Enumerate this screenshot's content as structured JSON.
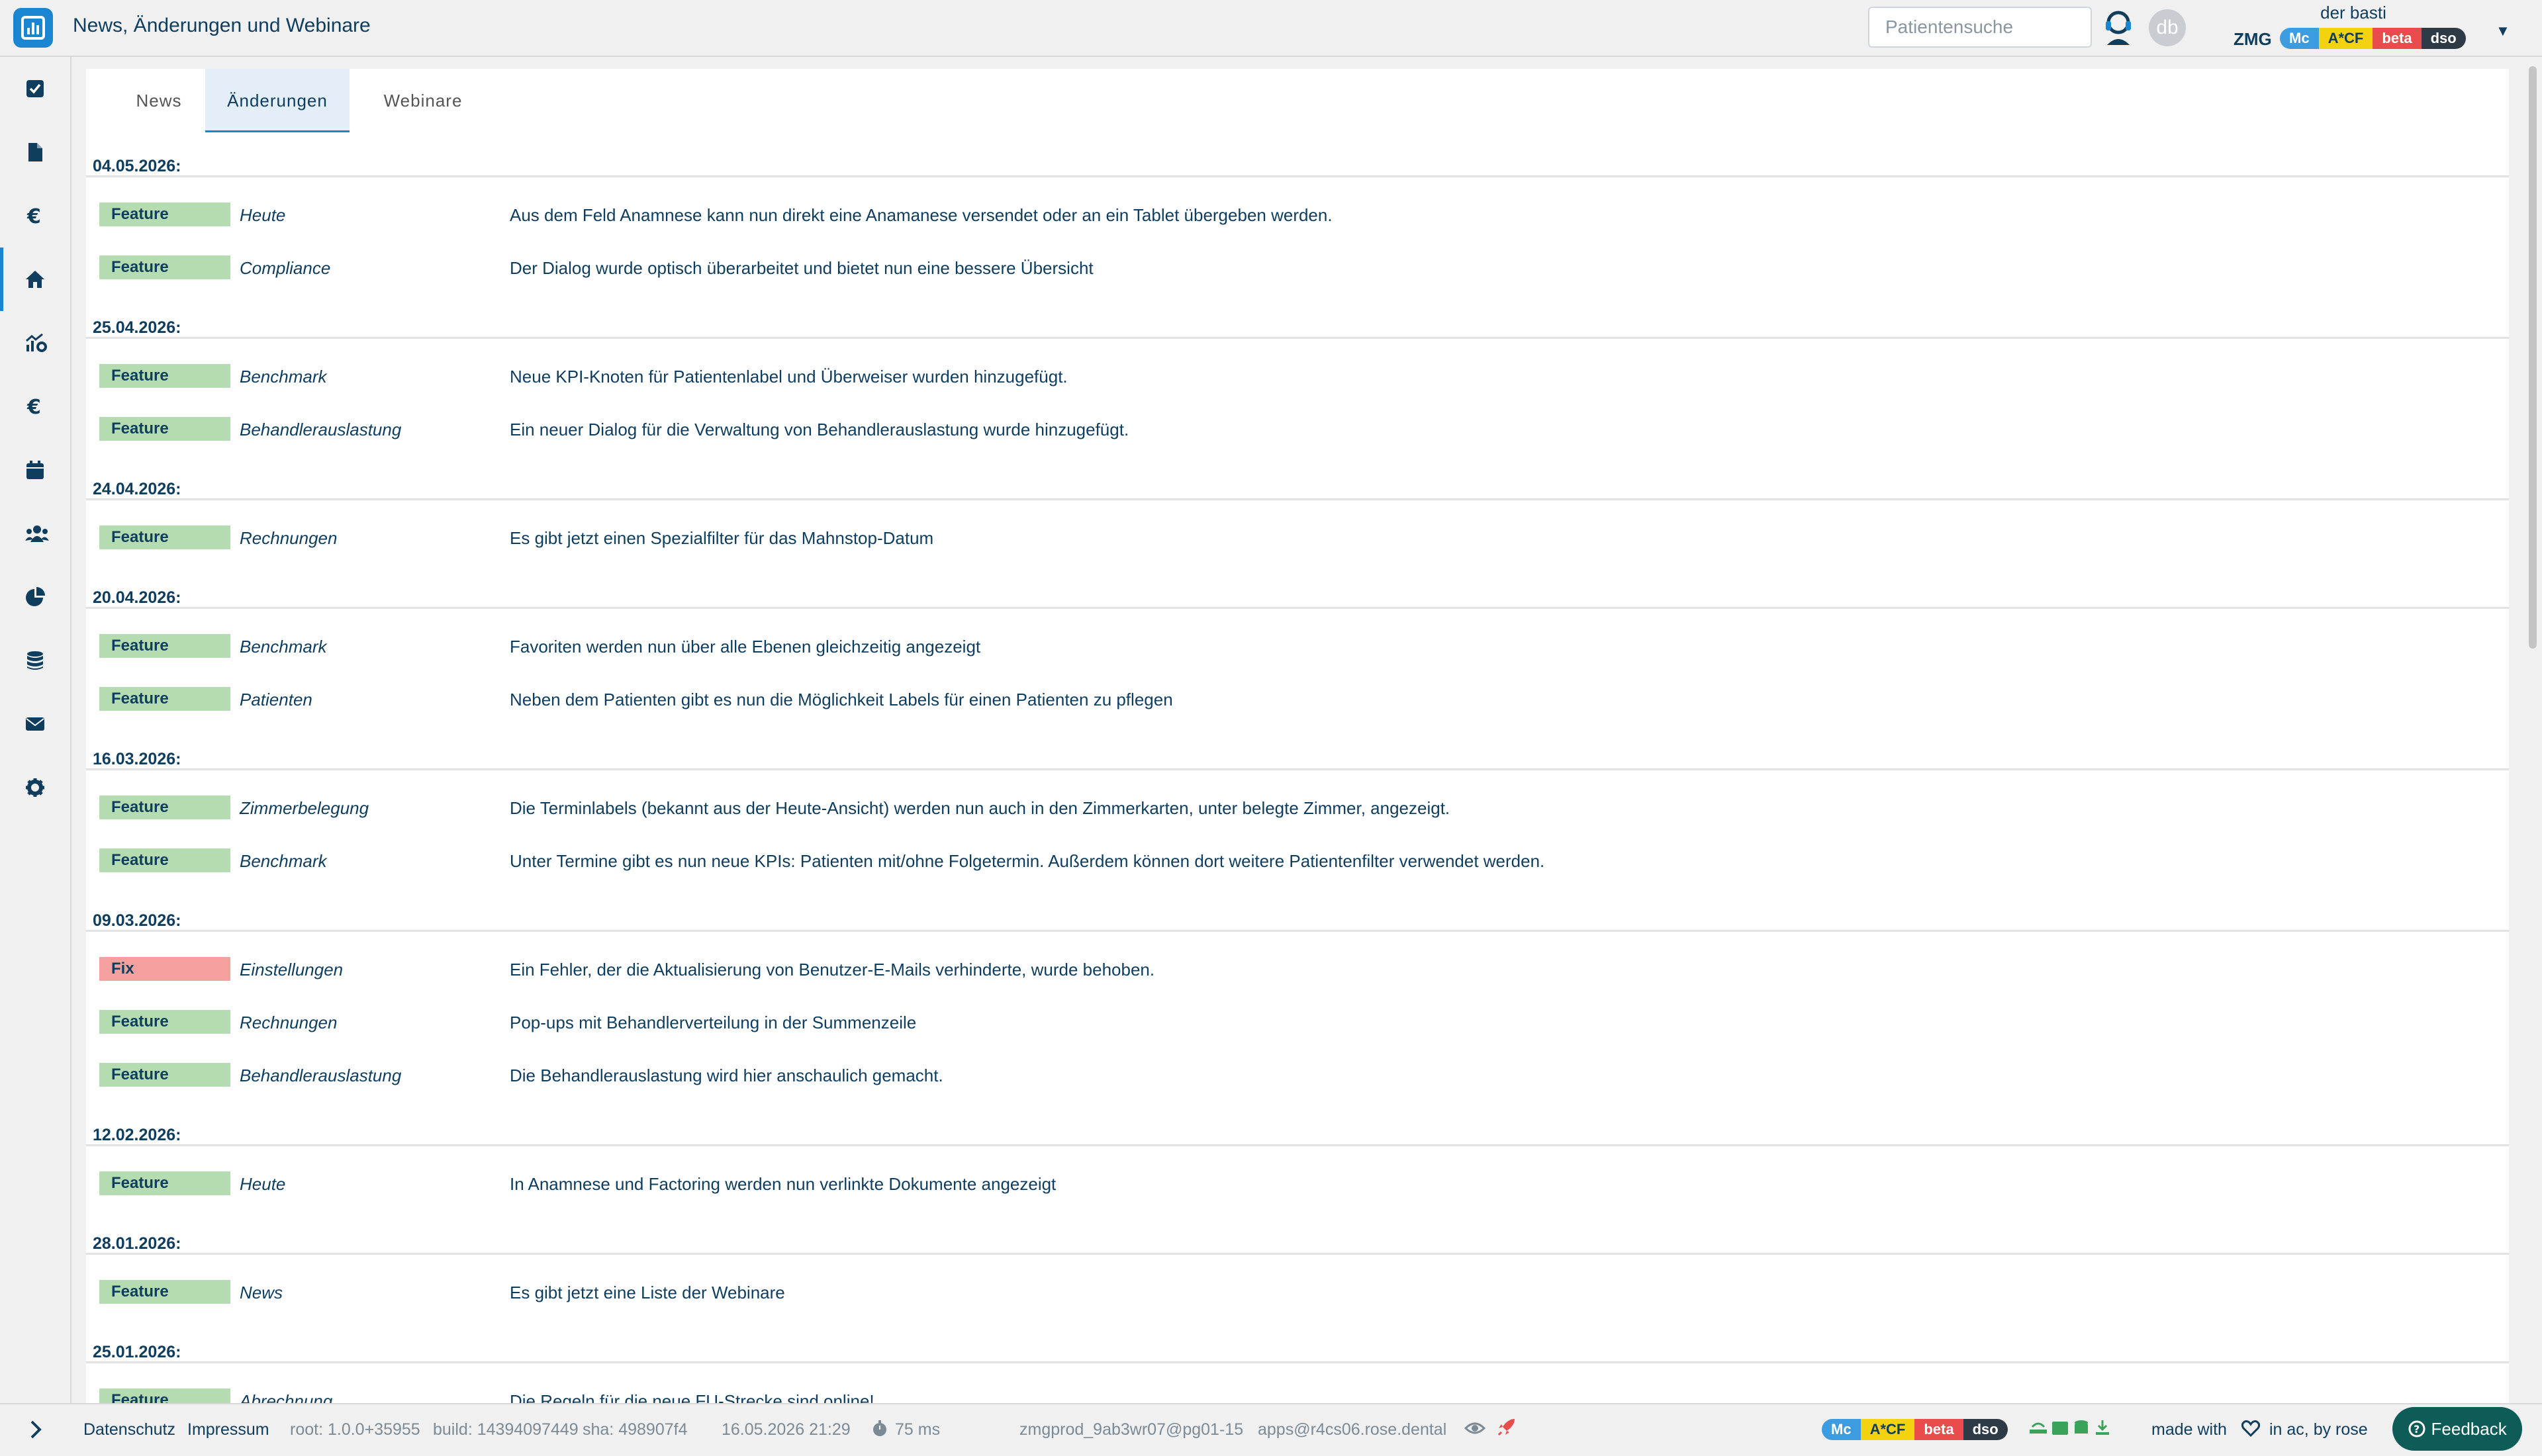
{
  "header": {
    "title": "News, Änderungen und Webinare",
    "search_placeholder": "Patientensuche",
    "avatar_initials": "db",
    "user_name": "der basti",
    "org": "ZMG",
    "badges": [
      "Mc",
      "A*CF",
      "beta",
      "dso"
    ]
  },
  "sidebar": {
    "items": [
      {
        "icon": "checkbox-icon"
      },
      {
        "icon": "document-icon"
      },
      {
        "icon": "euro-icon"
      },
      {
        "icon": "home-icon",
        "active": true
      },
      {
        "icon": "chart-settings-icon"
      },
      {
        "icon": "euro-icon"
      },
      {
        "icon": "calendar-icon"
      },
      {
        "icon": "users-icon"
      },
      {
        "icon": "pie-chart-icon"
      },
      {
        "icon": "database-icon"
      },
      {
        "icon": "mail-icon"
      },
      {
        "icon": "gear-icon"
      }
    ]
  },
  "tabs": [
    {
      "label": "News"
    },
    {
      "label": "Änderungen",
      "active": true
    },
    {
      "label": "Webinare"
    }
  ],
  "changes": [
    {
      "date": "04.05.2026:",
      "entries": [
        {
          "type": "Feature",
          "category": "Heute",
          "text": "Aus dem Feld Anamnese kann nun direkt eine Anamanese versendet oder an ein Tablet übergeben werden."
        },
        {
          "type": "Feature",
          "category": "Compliance",
          "text": "Der Dialog wurde optisch überarbeitet und bietet nun eine bessere Übersicht"
        }
      ]
    },
    {
      "date": "25.04.2026:",
      "entries": [
        {
          "type": "Feature",
          "category": "Benchmark",
          "text": "Neue KPI-Knoten für Patientenlabel und Überweiser wurden hinzugefügt."
        },
        {
          "type": "Feature",
          "category": "Behandlerauslastung",
          "text": "Ein neuer Dialog für die Verwaltung von Behandlerauslastung wurde hinzugefügt."
        }
      ]
    },
    {
      "date": "24.04.2026:",
      "entries": [
        {
          "type": "Feature",
          "category": "Rechnungen",
          "text": "Es gibt jetzt einen Spezialfilter für das Mahnstop-Datum"
        }
      ]
    },
    {
      "date": "20.04.2026:",
      "entries": [
        {
          "type": "Feature",
          "category": "Benchmark",
          "text": "Favoriten werden nun über alle Ebenen gleichzeitig angezeigt"
        },
        {
          "type": "Feature",
          "category": "Patienten",
          "text": "Neben dem Patienten gibt es nun die Möglichkeit Labels für einen Patienten zu pflegen"
        }
      ]
    },
    {
      "date": "16.03.2026:",
      "entries": [
        {
          "type": "Feature",
          "category": "Zimmerbelegung",
          "text": "Die Terminlabels (bekannt aus der Heute-Ansicht) werden nun auch in den Zimmerkarten, unter belegte Zimmer, angezeigt."
        },
        {
          "type": "Feature",
          "category": "Benchmark",
          "text": "Unter Termine gibt es nun neue KPIs: Patienten mit/ohne Folgetermin. Außerdem können dort weitere Patientenfilter verwendet werden."
        }
      ]
    },
    {
      "date": "09.03.2026:",
      "entries": [
        {
          "type": "Fix",
          "category": "Einstellungen",
          "text": "Ein Fehler, der die Aktualisierung von Benutzer-E-Mails verhinderte, wurde behoben."
        },
        {
          "type": "Feature",
          "category": "Rechnungen",
          "text": "Pop-ups mit Behandlerverteilung in der Summenzeile"
        },
        {
          "type": "Feature",
          "category": "Behandlerauslastung",
          "text": "Die Behandlerauslastung wird hier anschaulich gemacht."
        }
      ]
    },
    {
      "date": "12.02.2026:",
      "entries": [
        {
          "type": "Feature",
          "category": "Heute",
          "text": "In Anamnese und Factoring werden nun verlinkte Dokumente angezeigt"
        }
      ]
    },
    {
      "date": "28.01.2026:",
      "entries": [
        {
          "type": "Feature",
          "category": "News",
          "text": "Es gibt jetzt eine Liste der Webinare"
        }
      ]
    },
    {
      "date": "25.01.2026:",
      "entries": [
        {
          "type": "Feature",
          "category": "Abrechnung",
          "text": "Die Regeln für die neue FU-Strecke sind online!"
        }
      ]
    }
  ],
  "footer": {
    "datenschutz": "Datenschutz",
    "impressum": "Impressum",
    "root": "root: 1.0.0+35955",
    "build": "build: 14394097449",
    "sha": "sha: 498907f4",
    "datetime": "16.05.2026 21:29",
    "latency": "75 ms",
    "db_info": "zmgprod_9ab3wr07@pg01-15",
    "host": "apps@r4cs06.rose.dental",
    "badges": [
      "Mc",
      "A*CF",
      "beta",
      "dso"
    ],
    "made_with": "made with",
    "by": "in ac, by rose",
    "feedback": "Feedback"
  },
  "colors": {
    "accent": "#1a86d1",
    "text": "#0f3d5e",
    "feature": "#b5dcb1",
    "fix": "#f4a09e",
    "feedback": "#0d5c57"
  }
}
